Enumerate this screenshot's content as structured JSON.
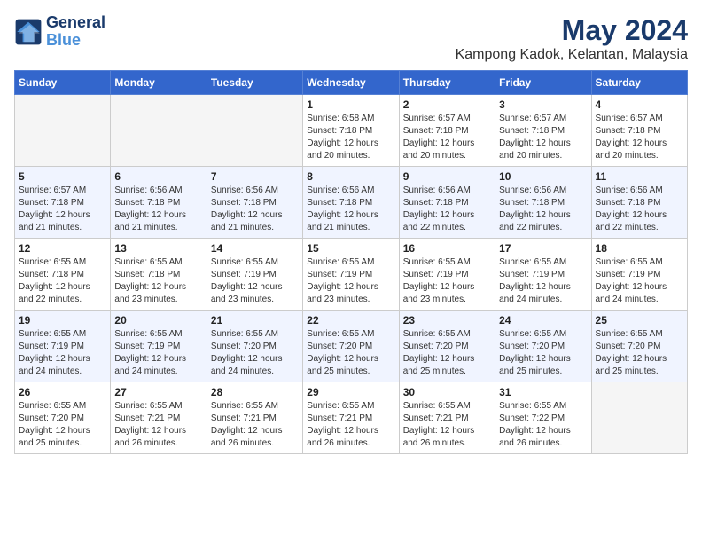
{
  "logo": {
    "text_general": "General",
    "text_blue": "Blue"
  },
  "title": "May 2024",
  "location": "Kampong Kadok, Kelantan, Malaysia",
  "days_of_week": [
    "Sunday",
    "Monday",
    "Tuesday",
    "Wednesday",
    "Thursday",
    "Friday",
    "Saturday"
  ],
  "weeks": [
    [
      {
        "day": "",
        "info": ""
      },
      {
        "day": "",
        "info": ""
      },
      {
        "day": "",
        "info": ""
      },
      {
        "day": "1",
        "info": "Sunrise: 6:58 AM\nSunset: 7:18 PM\nDaylight: 12 hours\nand 20 minutes."
      },
      {
        "day": "2",
        "info": "Sunrise: 6:57 AM\nSunset: 7:18 PM\nDaylight: 12 hours\nand 20 minutes."
      },
      {
        "day": "3",
        "info": "Sunrise: 6:57 AM\nSunset: 7:18 PM\nDaylight: 12 hours\nand 20 minutes."
      },
      {
        "day": "4",
        "info": "Sunrise: 6:57 AM\nSunset: 7:18 PM\nDaylight: 12 hours\nand 20 minutes."
      }
    ],
    [
      {
        "day": "5",
        "info": "Sunrise: 6:57 AM\nSunset: 7:18 PM\nDaylight: 12 hours\nand 21 minutes."
      },
      {
        "day": "6",
        "info": "Sunrise: 6:56 AM\nSunset: 7:18 PM\nDaylight: 12 hours\nand 21 minutes."
      },
      {
        "day": "7",
        "info": "Sunrise: 6:56 AM\nSunset: 7:18 PM\nDaylight: 12 hours\nand 21 minutes."
      },
      {
        "day": "8",
        "info": "Sunrise: 6:56 AM\nSunset: 7:18 PM\nDaylight: 12 hours\nand 21 minutes."
      },
      {
        "day": "9",
        "info": "Sunrise: 6:56 AM\nSunset: 7:18 PM\nDaylight: 12 hours\nand 22 minutes."
      },
      {
        "day": "10",
        "info": "Sunrise: 6:56 AM\nSunset: 7:18 PM\nDaylight: 12 hours\nand 22 minutes."
      },
      {
        "day": "11",
        "info": "Sunrise: 6:56 AM\nSunset: 7:18 PM\nDaylight: 12 hours\nand 22 minutes."
      }
    ],
    [
      {
        "day": "12",
        "info": "Sunrise: 6:55 AM\nSunset: 7:18 PM\nDaylight: 12 hours\nand 22 minutes."
      },
      {
        "day": "13",
        "info": "Sunrise: 6:55 AM\nSunset: 7:18 PM\nDaylight: 12 hours\nand 23 minutes."
      },
      {
        "day": "14",
        "info": "Sunrise: 6:55 AM\nSunset: 7:19 PM\nDaylight: 12 hours\nand 23 minutes."
      },
      {
        "day": "15",
        "info": "Sunrise: 6:55 AM\nSunset: 7:19 PM\nDaylight: 12 hours\nand 23 minutes."
      },
      {
        "day": "16",
        "info": "Sunrise: 6:55 AM\nSunset: 7:19 PM\nDaylight: 12 hours\nand 23 minutes."
      },
      {
        "day": "17",
        "info": "Sunrise: 6:55 AM\nSunset: 7:19 PM\nDaylight: 12 hours\nand 24 minutes."
      },
      {
        "day": "18",
        "info": "Sunrise: 6:55 AM\nSunset: 7:19 PM\nDaylight: 12 hours\nand 24 minutes."
      }
    ],
    [
      {
        "day": "19",
        "info": "Sunrise: 6:55 AM\nSunset: 7:19 PM\nDaylight: 12 hours\nand 24 minutes."
      },
      {
        "day": "20",
        "info": "Sunrise: 6:55 AM\nSunset: 7:19 PM\nDaylight: 12 hours\nand 24 minutes."
      },
      {
        "day": "21",
        "info": "Sunrise: 6:55 AM\nSunset: 7:20 PM\nDaylight: 12 hours\nand 24 minutes."
      },
      {
        "day": "22",
        "info": "Sunrise: 6:55 AM\nSunset: 7:20 PM\nDaylight: 12 hours\nand 25 minutes."
      },
      {
        "day": "23",
        "info": "Sunrise: 6:55 AM\nSunset: 7:20 PM\nDaylight: 12 hours\nand 25 minutes."
      },
      {
        "day": "24",
        "info": "Sunrise: 6:55 AM\nSunset: 7:20 PM\nDaylight: 12 hours\nand 25 minutes."
      },
      {
        "day": "25",
        "info": "Sunrise: 6:55 AM\nSunset: 7:20 PM\nDaylight: 12 hours\nand 25 minutes."
      }
    ],
    [
      {
        "day": "26",
        "info": "Sunrise: 6:55 AM\nSunset: 7:20 PM\nDaylight: 12 hours\nand 25 minutes."
      },
      {
        "day": "27",
        "info": "Sunrise: 6:55 AM\nSunset: 7:21 PM\nDaylight: 12 hours\nand 26 minutes."
      },
      {
        "day": "28",
        "info": "Sunrise: 6:55 AM\nSunset: 7:21 PM\nDaylight: 12 hours\nand 26 minutes."
      },
      {
        "day": "29",
        "info": "Sunrise: 6:55 AM\nSunset: 7:21 PM\nDaylight: 12 hours\nand 26 minutes."
      },
      {
        "day": "30",
        "info": "Sunrise: 6:55 AM\nSunset: 7:21 PM\nDaylight: 12 hours\nand 26 minutes."
      },
      {
        "day": "31",
        "info": "Sunrise: 6:55 AM\nSunset: 7:22 PM\nDaylight: 12 hours\nand 26 minutes."
      },
      {
        "day": "",
        "info": ""
      }
    ]
  ]
}
